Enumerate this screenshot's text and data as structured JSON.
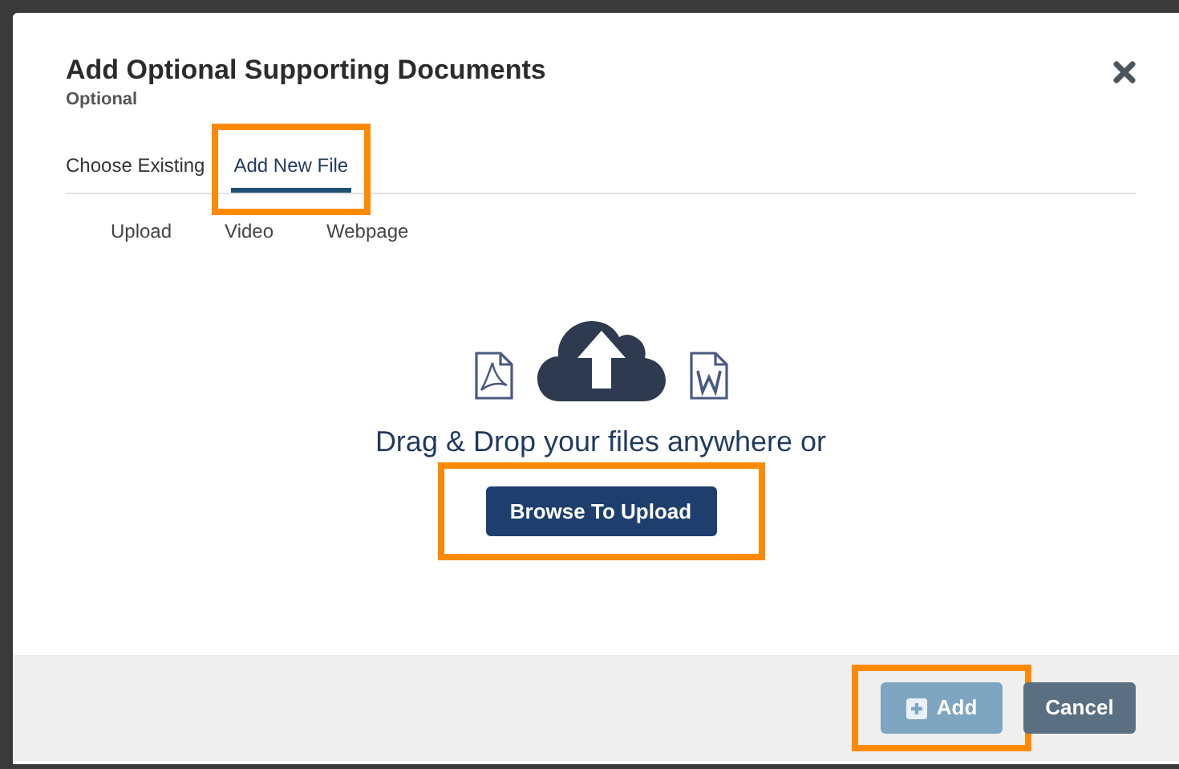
{
  "dialog": {
    "title": "Add Optional Supporting Documents",
    "subtitle": "Optional"
  },
  "tabs": [
    {
      "label": "Choose Existing",
      "selected": false,
      "highlighted": false
    },
    {
      "label": "Add New File",
      "selected": true,
      "highlighted": true
    }
  ],
  "source_options": [
    "Upload",
    "Video",
    "Webpage"
  ],
  "drop_zone": {
    "prompt": "Drag & Drop your files anywhere or",
    "browse_button": {
      "label": "Browse To Upload",
      "highlighted": true
    }
  },
  "footer_buttons": [
    {
      "kind": "add",
      "label": "Add",
      "disabled": true,
      "highlighted": true
    },
    {
      "kind": "cancel",
      "label": "Cancel",
      "disabled": false,
      "highlighted": false
    }
  ]
}
